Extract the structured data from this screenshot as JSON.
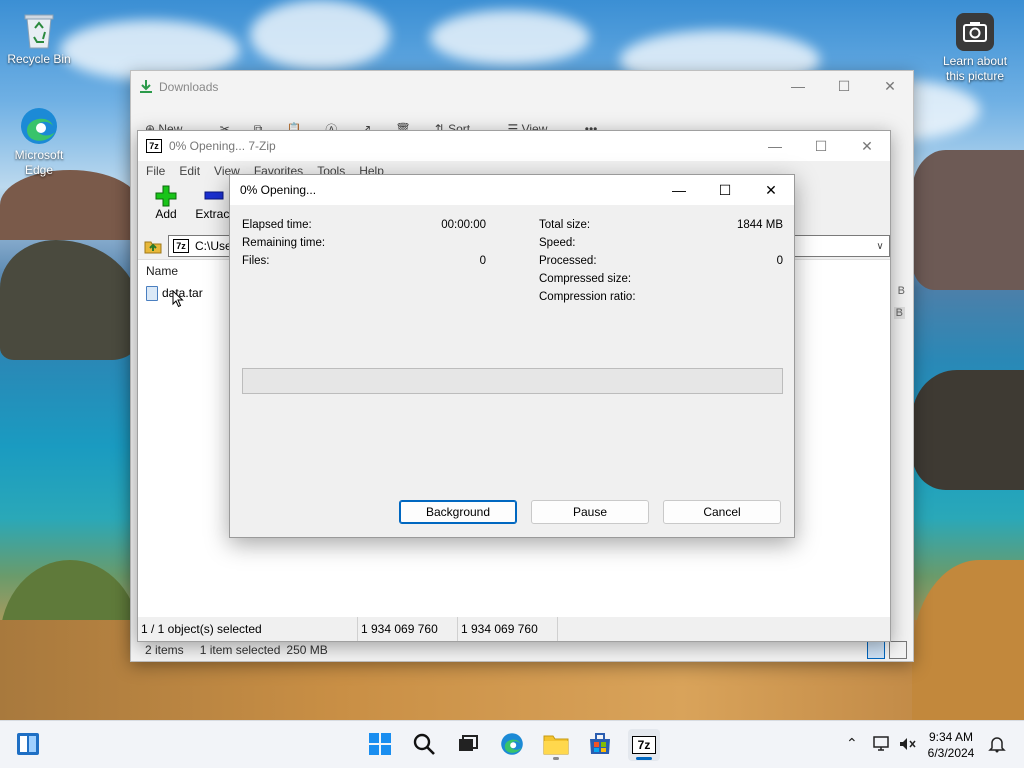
{
  "desktop": {
    "icons": [
      {
        "label": "Recycle Bin"
      },
      {
        "label": "Microsoft Edge"
      },
      {
        "label": "Learn about this picture"
      }
    ]
  },
  "explorer": {
    "title": "Downloads",
    "commands": [
      "New",
      "Sort",
      "View"
    ],
    "status": {
      "items": "2 items",
      "selected": "1 item selected",
      "size": "250 MB"
    },
    "partial_sizes": [
      "B",
      "B"
    ]
  },
  "sevenzip": {
    "title": "0% Opening... 7-Zip",
    "logo_text": "7z",
    "menu": [
      "File",
      "Edit",
      "View",
      "Favorites",
      "Tools",
      "Help"
    ],
    "toolbar": {
      "add": "Add",
      "extract": "Extract"
    },
    "address": "C:\\Use",
    "column_name": "Name",
    "file_name": "data.tar",
    "status": {
      "selected": "1 / 1 object(s) selected",
      "size": "1 934 069 760",
      "packed": "1 934 069 760"
    }
  },
  "dialog": {
    "title": "0% Opening...",
    "left": [
      {
        "label": "Elapsed time:",
        "value": "00:00:00"
      },
      {
        "label": "Remaining time:",
        "value": ""
      },
      {
        "label": "Files:",
        "value": "0"
      }
    ],
    "right": [
      {
        "label": "Total size:",
        "value": "1844 MB"
      },
      {
        "label": "Speed:",
        "value": ""
      },
      {
        "label": "Processed:",
        "value": "0"
      },
      {
        "label": "Compressed size:",
        "value": ""
      },
      {
        "label": "Compression ratio:",
        "value": ""
      }
    ],
    "progress_percent": 0,
    "buttons": {
      "background": "Background",
      "pause": "Pause",
      "cancel": "Cancel"
    }
  },
  "taskbar": {
    "time": "9:34 AM",
    "date": "6/3/2024",
    "pinned": [
      "start",
      "search",
      "task-view",
      "edge",
      "file-explorer",
      "store",
      "7-zip"
    ],
    "active_app": "7-zip"
  },
  "colors": {
    "accent": "#0067c0",
    "progress": "#06b025"
  }
}
